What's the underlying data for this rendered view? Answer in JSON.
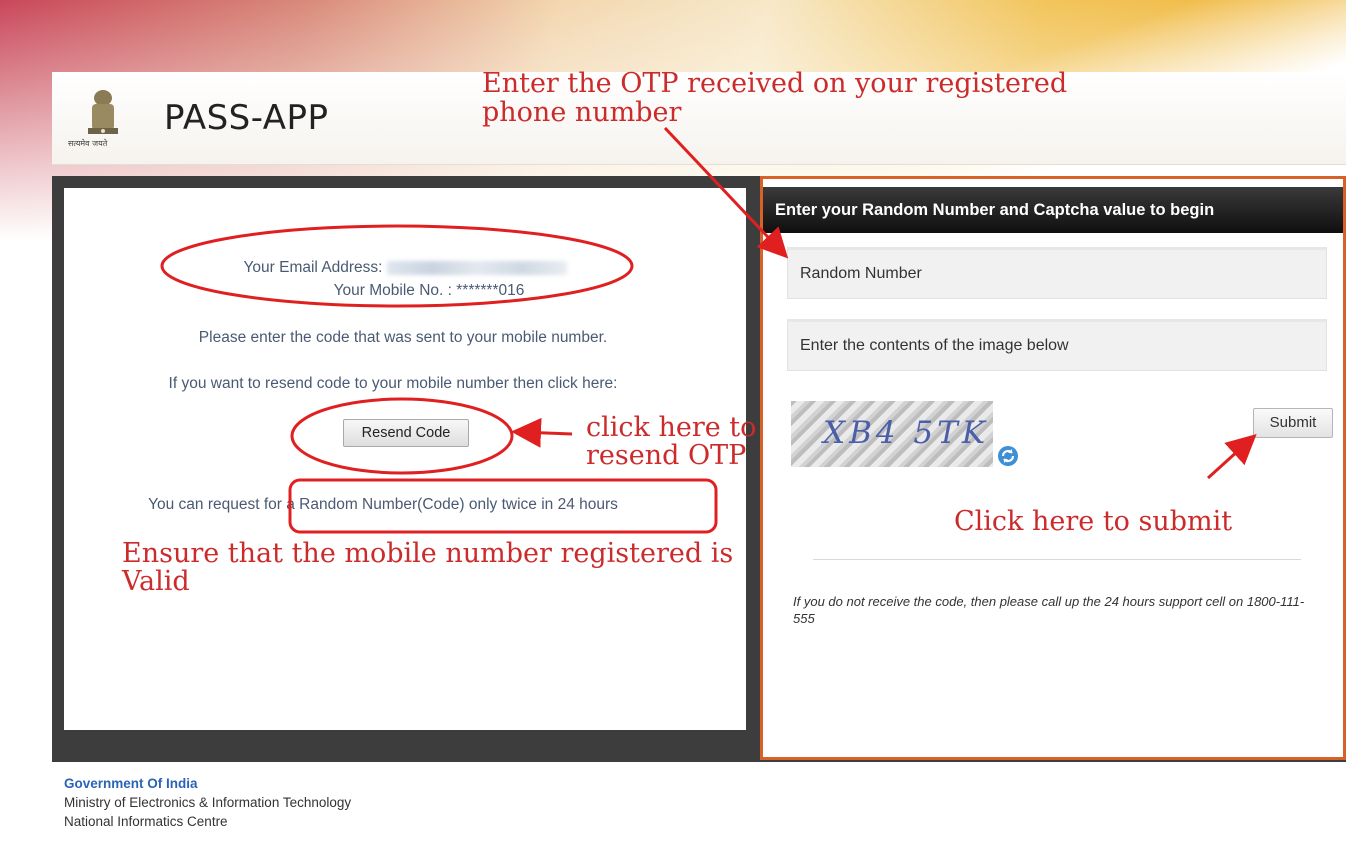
{
  "header": {
    "app_title": "PASS-APP",
    "emblem_caption": "सत्यमेव जयते"
  },
  "left": {
    "email_label": "Your Email Address:",
    "mobile_line": "Your Mobile No. : *******016",
    "enter_code_text": "Please enter the code that was sent to your mobile number.",
    "resend_text": "If you want to resend code to your mobile number then click here:",
    "resend_button": "Resend Code",
    "limit_text": "You can request for a Random Number(Code) only twice in 24 hours"
  },
  "right": {
    "header": "Enter your Random Number and Captcha value to begin",
    "random_number_placeholder": "Random Number",
    "captcha_placeholder": "Enter the contents of the image below",
    "captcha_text": "XB4 5TK",
    "submit_button": "Submit",
    "support_note": "If you do not receive the code, then please call up the 24 hours support cell on 1800-111-555"
  },
  "footer": {
    "line1": "Government Of India",
    "line2": "Ministry of Electronics & Information Technology",
    "line3": "National Informatics Centre"
  },
  "annotations": {
    "otp_line1": "Enter the OTP received on your registered",
    "otp_line2": "phone number",
    "resend_line1": "click here to",
    "resend_line2": "resend OTP",
    "ensure_line1": "Ensure that the mobile number registered is",
    "ensure_line2": "Valid",
    "submit_note": "Click here to submit",
    "color": "#cc2b2b"
  },
  "icons": {
    "emblem": "national-emblem-icon",
    "refresh": "refresh-icon"
  }
}
